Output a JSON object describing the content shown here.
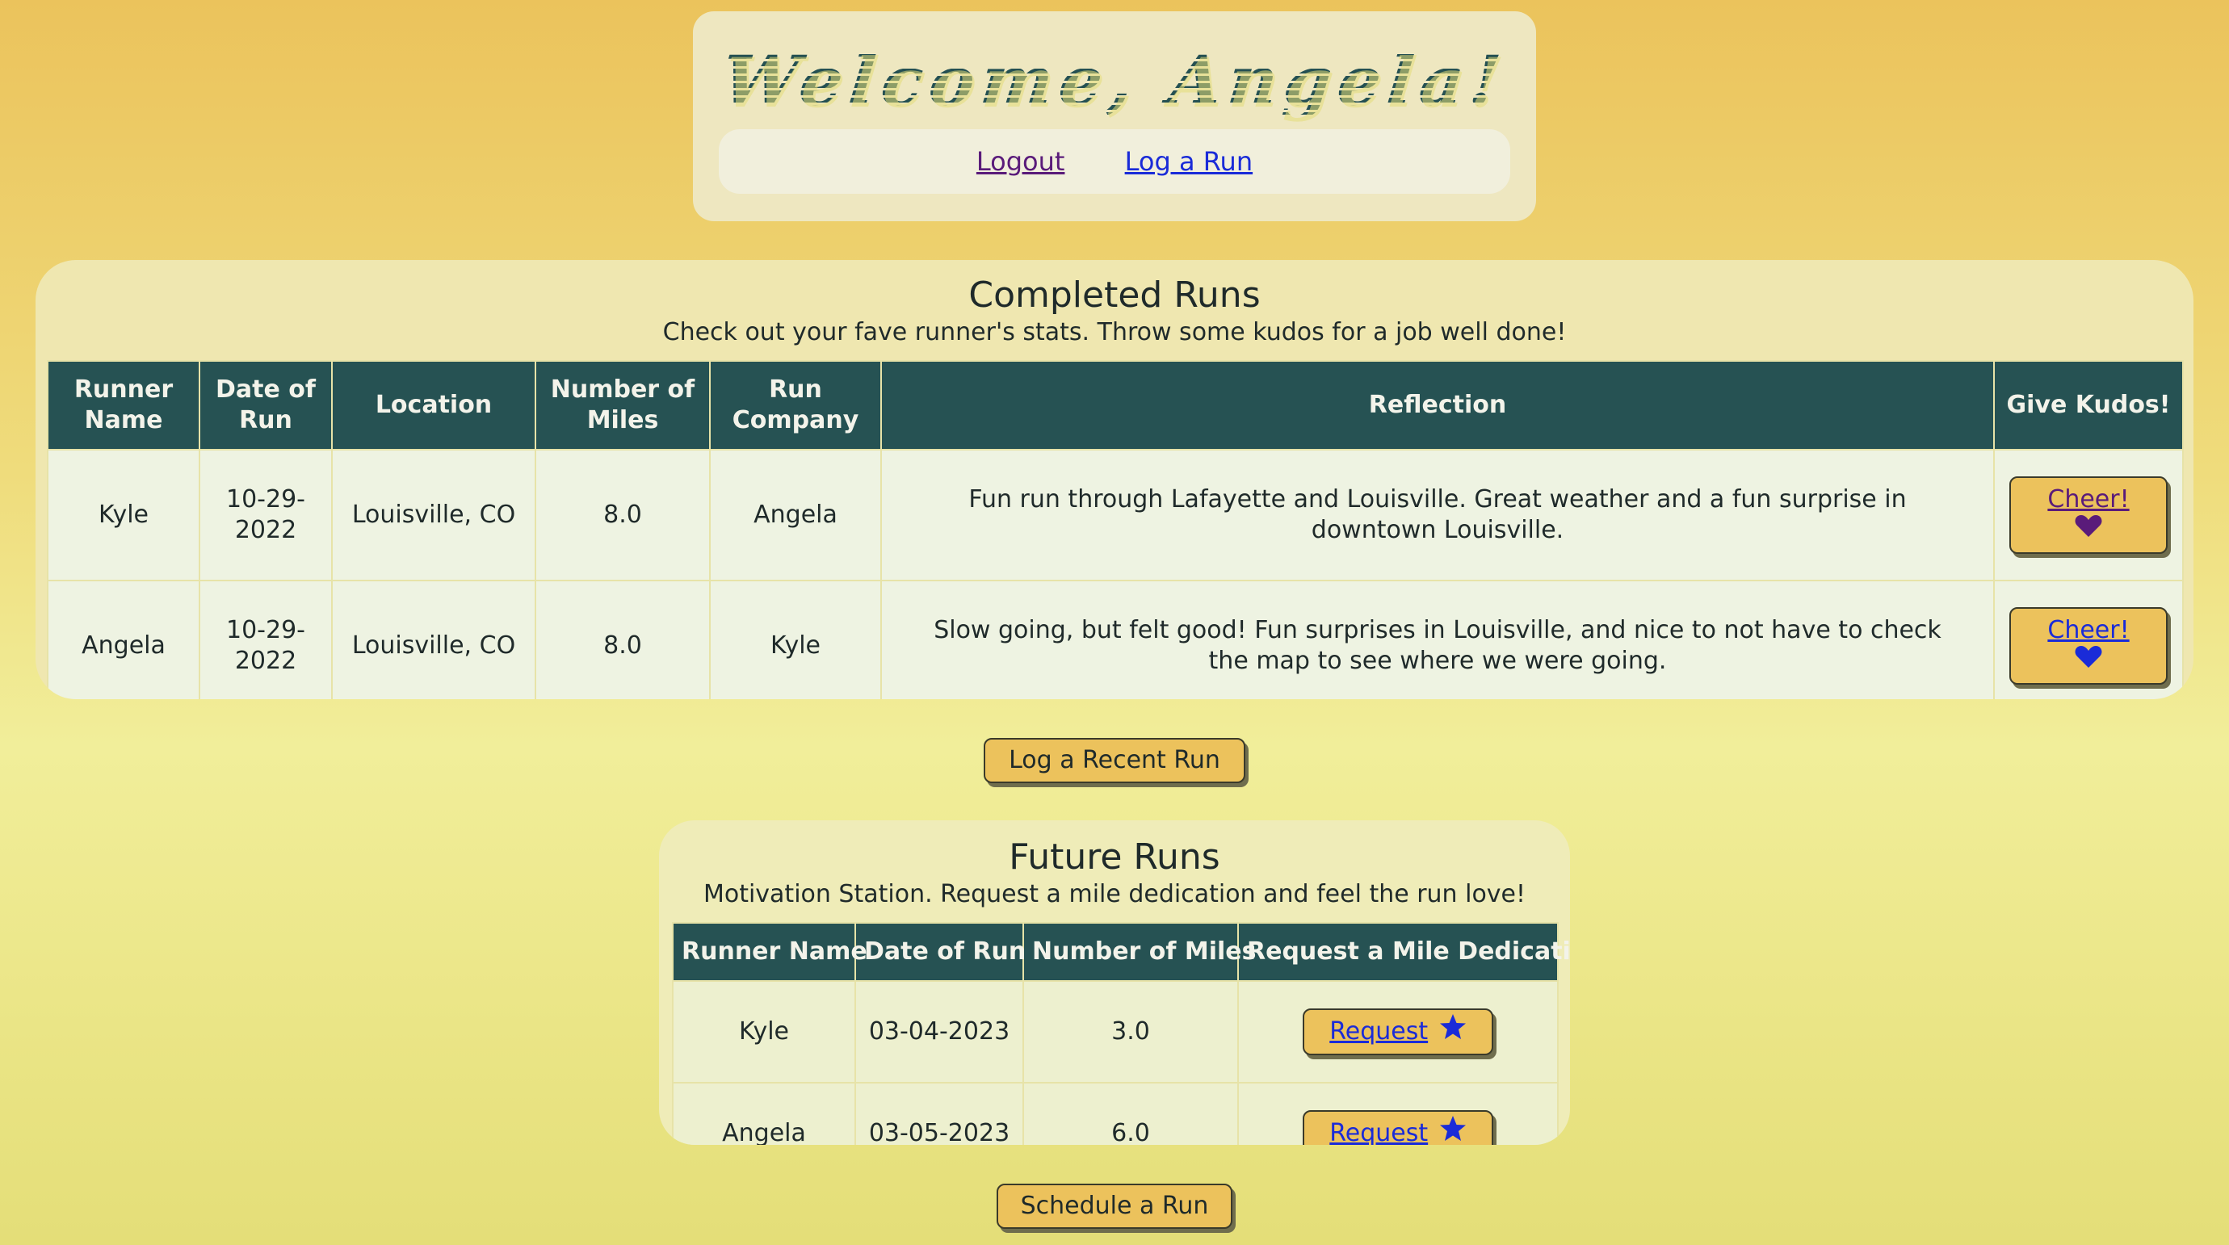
{
  "header": {
    "welcome": "Welcome, Angela!",
    "nav": {
      "logout": "Logout",
      "log_run": "Log a Run"
    }
  },
  "completed": {
    "title": "Completed Runs",
    "subtitle": "Check out your fave runner's stats. Throw some kudos for a job well done!",
    "columns": [
      "Runner Name",
      "Date of Run",
      "Location",
      "Number of Miles",
      "Run Company",
      "Reflection",
      "Give Kudos!"
    ],
    "rows": [
      {
        "runner": "Kyle",
        "date": "10-29-2022",
        "location": "Louisville, CO",
        "miles": "8.0",
        "company": "Angela",
        "reflection": "Fun run through Lafayette and Louisville. Great weather and a fun surprise in downtown Louisville.",
        "kudos": "Cheer!"
      },
      {
        "runner": "Angela",
        "date": "10-29-2022",
        "location": "Louisville, CO",
        "miles": "8.0",
        "company": "Kyle",
        "reflection": "Slow going, but felt good! Fun surprises in Louisville, and nice to not have to check the map to see where we were going.",
        "kudos": "Cheer!"
      }
    ]
  },
  "buttons": {
    "log_recent": "Log a Recent Run",
    "schedule": "Schedule a Run"
  },
  "future": {
    "title": "Future Runs",
    "subtitle": "Motivation Station. Request a mile dedication and feel the run love!",
    "columns": [
      "Runner Name",
      "Date of Run",
      "Number of Miles",
      "Request a Mile Dedication"
    ],
    "rows": [
      {
        "runner": "Kyle",
        "date": "03-04-2023",
        "miles": "3.0",
        "request": "Request"
      },
      {
        "runner": "Angela",
        "date": "03-05-2023",
        "miles": "6.0",
        "request": "Request"
      }
    ]
  },
  "colors": {
    "header_teal": "#265253",
    "button_gold": "#ecc25c",
    "link_blue": "#1a2bd8",
    "link_visited": "#5a1b7a"
  },
  "icons": {
    "kudos": "heart-icon",
    "request": "star-icon"
  }
}
